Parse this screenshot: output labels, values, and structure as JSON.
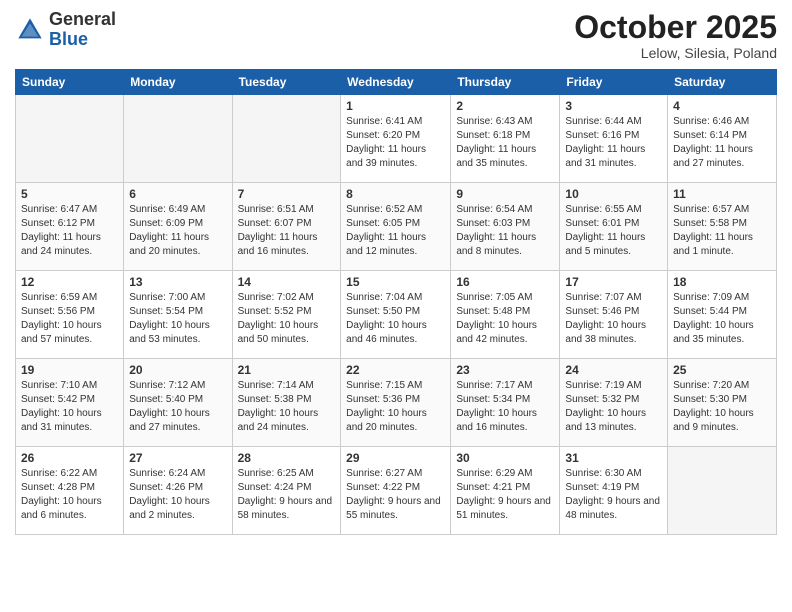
{
  "logo": {
    "general": "General",
    "blue": "Blue"
  },
  "header": {
    "month": "October 2025",
    "location": "Lelow, Silesia, Poland"
  },
  "weekdays": [
    "Sunday",
    "Monday",
    "Tuesday",
    "Wednesday",
    "Thursday",
    "Friday",
    "Saturday"
  ],
  "weeks": [
    [
      {
        "day": "",
        "empty": true
      },
      {
        "day": "",
        "empty": true
      },
      {
        "day": "",
        "empty": true
      },
      {
        "day": "1",
        "sunrise": "6:41 AM",
        "sunset": "6:20 PM",
        "daylight": "11 hours and 39 minutes."
      },
      {
        "day": "2",
        "sunrise": "6:43 AM",
        "sunset": "6:18 PM",
        "daylight": "11 hours and 35 minutes."
      },
      {
        "day": "3",
        "sunrise": "6:44 AM",
        "sunset": "6:16 PM",
        "daylight": "11 hours and 31 minutes."
      },
      {
        "day": "4",
        "sunrise": "6:46 AM",
        "sunset": "6:14 PM",
        "daylight": "11 hours and 27 minutes."
      }
    ],
    [
      {
        "day": "5",
        "sunrise": "6:47 AM",
        "sunset": "6:12 PM",
        "daylight": "11 hours and 24 minutes."
      },
      {
        "day": "6",
        "sunrise": "6:49 AM",
        "sunset": "6:09 PM",
        "daylight": "11 hours and 20 minutes."
      },
      {
        "day": "7",
        "sunrise": "6:51 AM",
        "sunset": "6:07 PM",
        "daylight": "11 hours and 16 minutes."
      },
      {
        "day": "8",
        "sunrise": "6:52 AM",
        "sunset": "6:05 PM",
        "daylight": "11 hours and 12 minutes."
      },
      {
        "day": "9",
        "sunrise": "6:54 AM",
        "sunset": "6:03 PM",
        "daylight": "11 hours and 8 minutes."
      },
      {
        "day": "10",
        "sunrise": "6:55 AM",
        "sunset": "6:01 PM",
        "daylight": "11 hours and 5 minutes."
      },
      {
        "day": "11",
        "sunrise": "6:57 AM",
        "sunset": "5:58 PM",
        "daylight": "11 hours and 1 minute."
      }
    ],
    [
      {
        "day": "12",
        "sunrise": "6:59 AM",
        "sunset": "5:56 PM",
        "daylight": "10 hours and 57 minutes."
      },
      {
        "day": "13",
        "sunrise": "7:00 AM",
        "sunset": "5:54 PM",
        "daylight": "10 hours and 53 minutes."
      },
      {
        "day": "14",
        "sunrise": "7:02 AM",
        "sunset": "5:52 PM",
        "daylight": "10 hours and 50 minutes."
      },
      {
        "day": "15",
        "sunrise": "7:04 AM",
        "sunset": "5:50 PM",
        "daylight": "10 hours and 46 minutes."
      },
      {
        "day": "16",
        "sunrise": "7:05 AM",
        "sunset": "5:48 PM",
        "daylight": "10 hours and 42 minutes."
      },
      {
        "day": "17",
        "sunrise": "7:07 AM",
        "sunset": "5:46 PM",
        "daylight": "10 hours and 38 minutes."
      },
      {
        "day": "18",
        "sunrise": "7:09 AM",
        "sunset": "5:44 PM",
        "daylight": "10 hours and 35 minutes."
      }
    ],
    [
      {
        "day": "19",
        "sunrise": "7:10 AM",
        "sunset": "5:42 PM",
        "daylight": "10 hours and 31 minutes."
      },
      {
        "day": "20",
        "sunrise": "7:12 AM",
        "sunset": "5:40 PM",
        "daylight": "10 hours and 27 minutes."
      },
      {
        "day": "21",
        "sunrise": "7:14 AM",
        "sunset": "5:38 PM",
        "daylight": "10 hours and 24 minutes."
      },
      {
        "day": "22",
        "sunrise": "7:15 AM",
        "sunset": "5:36 PM",
        "daylight": "10 hours and 20 minutes."
      },
      {
        "day": "23",
        "sunrise": "7:17 AM",
        "sunset": "5:34 PM",
        "daylight": "10 hours and 16 minutes."
      },
      {
        "day": "24",
        "sunrise": "7:19 AM",
        "sunset": "5:32 PM",
        "daylight": "10 hours and 13 minutes."
      },
      {
        "day": "25",
        "sunrise": "7:20 AM",
        "sunset": "5:30 PM",
        "daylight": "10 hours and 9 minutes."
      }
    ],
    [
      {
        "day": "26",
        "sunrise": "6:22 AM",
        "sunset": "4:28 PM",
        "daylight": "10 hours and 6 minutes."
      },
      {
        "day": "27",
        "sunrise": "6:24 AM",
        "sunset": "4:26 PM",
        "daylight": "10 hours and 2 minutes."
      },
      {
        "day": "28",
        "sunrise": "6:25 AM",
        "sunset": "4:24 PM",
        "daylight": "9 hours and 58 minutes."
      },
      {
        "day": "29",
        "sunrise": "6:27 AM",
        "sunset": "4:22 PM",
        "daylight": "9 hours and 55 minutes."
      },
      {
        "day": "30",
        "sunrise": "6:29 AM",
        "sunset": "4:21 PM",
        "daylight": "9 hours and 51 minutes."
      },
      {
        "day": "31",
        "sunrise": "6:30 AM",
        "sunset": "4:19 PM",
        "daylight": "9 hours and 48 minutes."
      },
      {
        "day": "",
        "empty": true
      }
    ]
  ]
}
